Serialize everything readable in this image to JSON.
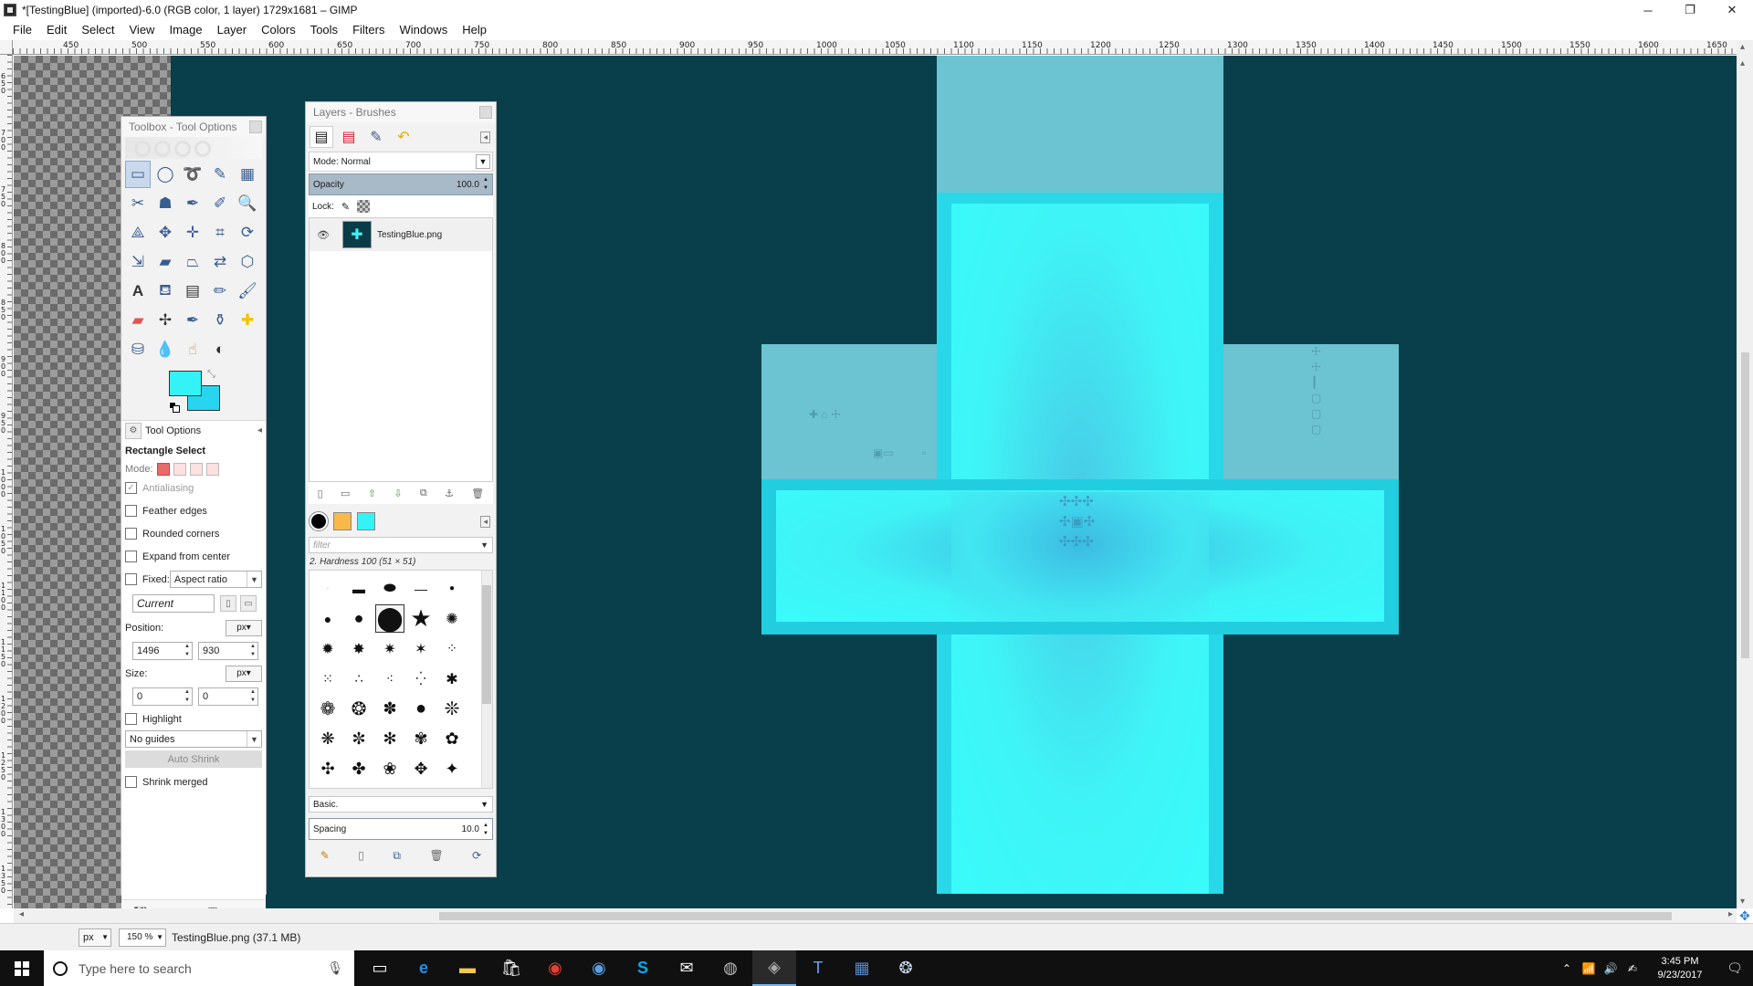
{
  "window": {
    "title": "*[TestingBlue] (imported)-6.0 (RGB color, 1 layer) 1729x1681 – GIMP",
    "minimize": "─",
    "maximize": "❐",
    "close": "✕"
  },
  "menu": [
    "File",
    "Edit",
    "Select",
    "View",
    "Image",
    "Layer",
    "Colors",
    "Tools",
    "Filters",
    "Windows",
    "Help"
  ],
  "ruler": {
    "h_ticks": [
      "450",
      "500",
      "550",
      "600",
      "650",
      "700",
      "750",
      "800",
      "850",
      "900",
      "950",
      "1000",
      "1050",
      "1100",
      "1150",
      "1200",
      "1250",
      "1300",
      "1350",
      "1400",
      "1450",
      "1500",
      "1550",
      "1600",
      "1650"
    ],
    "v_ticks": [
      "650",
      "700",
      "750",
      "800",
      "850",
      "900",
      "950",
      "1000",
      "1050",
      "1100",
      "1150",
      "1200",
      "1250",
      "1300",
      "1350"
    ]
  },
  "toolbox": {
    "title": "Toolbox - Tool Options",
    "tool_options_tab": "Tool Options",
    "tool_name": "Rectangle Select",
    "mode_label": "Mode:",
    "antialiasing": "Antialiasing",
    "feather_edges": "Feather edges",
    "rounded_corners": "Rounded corners",
    "expand_from_center": "Expand from center",
    "fixed_label": "Fixed:",
    "fixed_value": "Aspect ratio",
    "current_value": "Current",
    "position_label": "Position:",
    "position_unit": "px",
    "position_x": "1496",
    "position_y": "930",
    "size_label": "Size:",
    "size_unit": "px",
    "size_w": "0",
    "size_h": "0",
    "highlight": "Highlight",
    "guides_value": "No guides",
    "auto_shrink": "Auto Shrink",
    "shrink_merged": "Shrink merged"
  },
  "colors": {
    "foreground": "#33f3f6",
    "background": "#29d4ef"
  },
  "layers": {
    "title": "Layers - Brushes",
    "mode_label": "Mode:",
    "mode_value": "Normal",
    "opacity_label": "Opacity",
    "opacity_value": "100.0",
    "lock_label": "Lock:",
    "layer_name": "TestingBlue.png",
    "brush_filter_placeholder": "filter",
    "brush_name": "2. Hardness 100 (51 × 51)",
    "preset_value": "Basic.",
    "spacing_label": "Spacing",
    "spacing_value": "10.0"
  },
  "status": {
    "unit": "px",
    "zoom": "150 %",
    "info": "TestingBlue.png (37.1 MB)"
  },
  "taskbar": {
    "search_placeholder": "Type here to search",
    "time": "3:45 PM",
    "date": "9/23/2017"
  },
  "canvas": {
    "background_color": "#083f4a",
    "cross_color": "#3ff2f5",
    "arm_color": "#6cc3d1"
  }
}
